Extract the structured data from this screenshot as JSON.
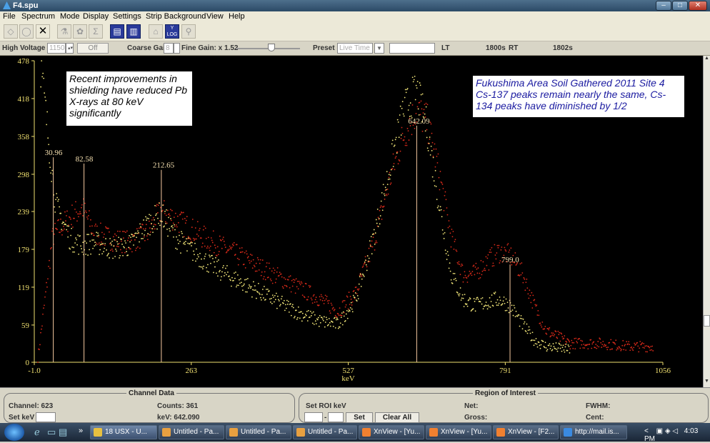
{
  "window": {
    "title": "F4.spu"
  },
  "menu": [
    "File",
    "Spectrum",
    "Mode",
    "Display",
    "Settings",
    "Strip Background",
    "View",
    "Help"
  ],
  "toolbar": {
    "close_glyph": "✕",
    "log_label": "Y\nLOG"
  },
  "controls": {
    "high_voltage_label": "High Voltage",
    "high_voltage_value": "1150",
    "off_label": "Off",
    "coarse_gain_label": "Coarse Gain",
    "coarse_gain_value": "8",
    "fine_gain_label": "Fine Gain: x 1.52",
    "fine_gain_value": 0.55,
    "preset_label": "Preset",
    "preset_value": "Live Time",
    "lt_label": "LT",
    "lt_value": "1800s",
    "rt_label": "RT",
    "rt_value": "1802s"
  },
  "notes": {
    "left": "Recent improvements in shielding have reduced Pb X-rays at 80 keV significantly",
    "right": "Fukushima Area Soil Gathered 2011 Site 4 Cs-137 peaks remain nearly the same, Cs-134 peaks have diminished by 1/2"
  },
  "chart_data": {
    "type": "scatter",
    "xlabel": "keV",
    "xlim": [
      -1.0,
      1056
    ],
    "ylim": [
      0,
      478
    ],
    "x_ticks": [
      "-1.0",
      "263",
      "527",
      "791",
      "1056"
    ],
    "x_tick_values": [
      -1.0,
      263,
      527,
      791,
      1056
    ],
    "y_ticks": [
      "0",
      "59",
      "119",
      "179",
      "239",
      "298",
      "358",
      "418",
      "478"
    ],
    "y_tick_values": [
      0,
      59,
      119,
      179,
      239,
      298,
      358,
      418,
      478
    ],
    "peak_markers": [
      {
        "label": "30.96",
        "x": 30.96,
        "y": 325
      },
      {
        "label": "82.58",
        "x": 82.58,
        "y": 315
      },
      {
        "label": "212.65",
        "x": 212.65,
        "y": 305
      },
      {
        "label": "642.09",
        "x": 642.09,
        "y": 375
      },
      {
        "label": "799.0",
        "x": 799.0,
        "y": 155
      }
    ],
    "series": [
      {
        "color": "#d82a1a",
        "x": [
          5,
          30,
          60,
          80,
          100,
          130,
          160,
          190,
          212,
          240,
          280,
          320,
          360,
          400,
          440,
          480,
          510,
          540,
          570,
          600,
          620,
          642,
          660,
          680,
          700,
          720,
          740,
          760,
          780,
          799,
          820,
          840,
          860,
          900,
          950,
          1000,
          1040
        ],
        "y": [
          5,
          200,
          230,
          245,
          205,
          195,
          190,
          205,
          240,
          225,
          200,
          180,
          160,
          140,
          120,
          100,
          80,
          110,
          190,
          300,
          360,
          400,
          380,
          300,
          200,
          140,
          140,
          160,
          175,
          170,
          140,
          90,
          50,
          30,
          30,
          25,
          25
        ]
      },
      {
        "color": "#f4e87a",
        "x": [
          10,
          20,
          35,
          60,
          80,
          100,
          130,
          160,
          190,
          212,
          240,
          280,
          320,
          360,
          400,
          440,
          480,
          510,
          540,
          570,
          600,
          620,
          642,
          660,
          680,
          700,
          720,
          740,
          760,
          780,
          799,
          820,
          840,
          860,
          900
        ],
        "y": [
          470,
          380,
          250,
          195,
          185,
          190,
          180,
          185,
          220,
          235,
          195,
          165,
          140,
          120,
          100,
          80,
          65,
          60,
          100,
          200,
          320,
          400,
          430,
          370,
          250,
          140,
          100,
          90,
          95,
          100,
          90,
          60,
          35,
          25,
          20
        ]
      }
    ]
  },
  "status": {
    "channel_data_title": "Channel Data",
    "channel": "Channel: 623",
    "counts": "Counts: 361",
    "set_kev_label": "Set keV",
    "kev": "keV: 642.090",
    "roi_title": "Region of Interest",
    "set_roi_label": "Set ROI keV",
    "roi_dash": "-",
    "set_button": "Set",
    "clear_all_button": "Clear All",
    "net": "Net:",
    "gross": "Gross:",
    "fwhm": "FWHM:",
    "cent": "Cent:"
  },
  "taskbar": {
    "overflow": "»",
    "tasks": [
      {
        "label": "18 USX - U...",
        "icon_color": "#e8c040",
        "active": true
      },
      {
        "label": "Untitled - Pa...",
        "icon_color": "#e8a040",
        "active": false
      },
      {
        "label": "Untitled - Pa...",
        "icon_color": "#e8a040",
        "active": false
      },
      {
        "label": "Untitled - Pa...",
        "icon_color": "#e8a040",
        "active": false
      },
      {
        "label": "XnView - [Yu...",
        "icon_color": "#f08030",
        "active": false
      },
      {
        "label": "XnView - [Yu...",
        "icon_color": "#f08030",
        "active": false
      },
      {
        "label": "XnView - [F2...",
        "icon_color": "#f08030",
        "active": false
      },
      {
        "label": "http://mail.is...",
        "icon_color": "#3a8ae0",
        "active": false
      }
    ],
    "tray_arrow": "<",
    "clock": "4:03 PM"
  }
}
